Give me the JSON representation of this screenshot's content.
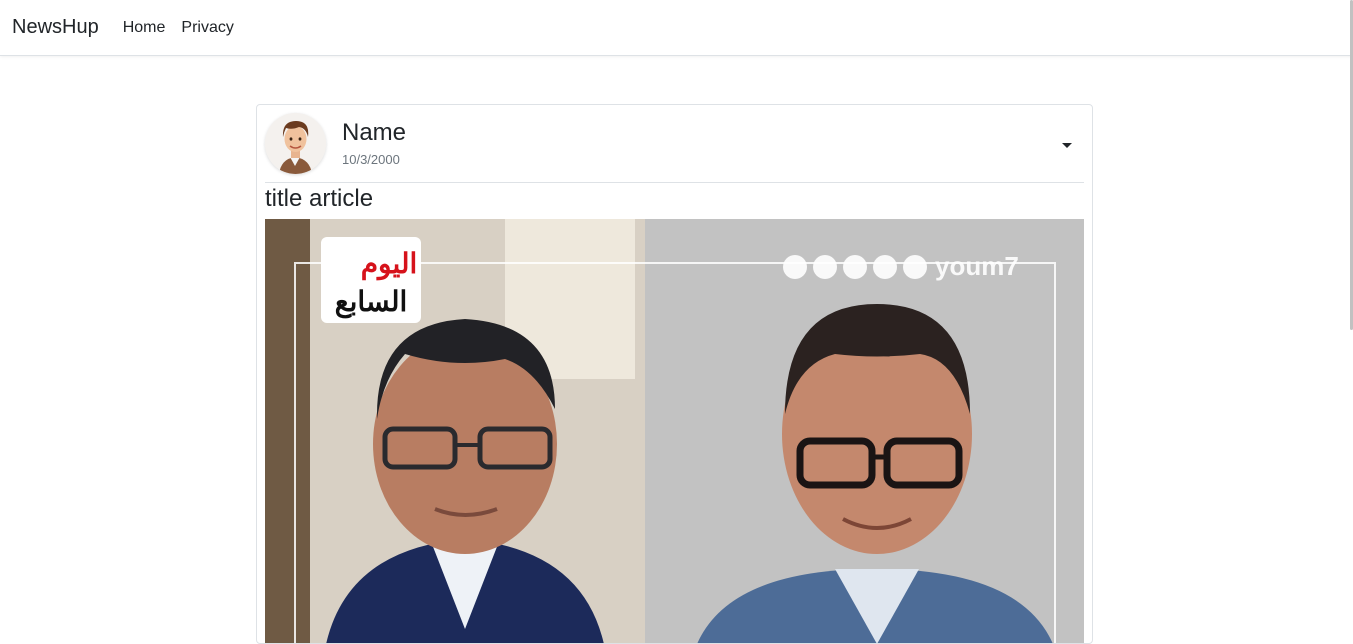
{
  "navbar": {
    "brand": "NewsHup",
    "links": [
      {
        "label": "Home"
      },
      {
        "label": "Privacy"
      }
    ]
  },
  "post": {
    "author_name": "Name",
    "date": "10/3/2000",
    "title": "title article",
    "image": {
      "logo_lines": [
        "اليوم",
        "السابع"
      ],
      "watermark": "youm7",
      "social_icons": [
        "facebook-icon",
        "x-icon",
        "instagram-icon",
        "youtube-icon",
        "tiktok-icon"
      ]
    }
  },
  "colors": {
    "border": "#dee2e6",
    "text": "#212529",
    "muted": "#6c757d",
    "logo_red": "#d6121b"
  }
}
